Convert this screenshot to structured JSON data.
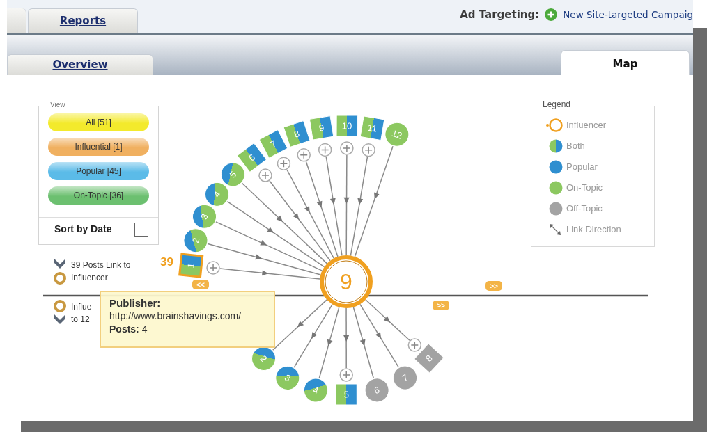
{
  "top_tabs": [
    {
      "label": "Reports",
      "selected": false
    }
  ],
  "ad_targeting": {
    "label": "Ad Targeting:",
    "link": "New Site-targeted Campaig"
  },
  "sub_tabs": [
    {
      "label": "Overview",
      "selected": false
    },
    {
      "label": "Map",
      "selected": true
    }
  ],
  "view_panel": {
    "title": "View",
    "filters": [
      {
        "label": "All [51]",
        "color": "#f3ea2c"
      },
      {
        "label": "Influential [1]",
        "color": "#f0b060"
      },
      {
        "label": "Popular [45]",
        "color": "#5bbbe8"
      },
      {
        "label": "On-Topic [36]",
        "color": "#6cc070"
      }
    ],
    "sort": {
      "label": "Sort by Date",
      "checked": false
    }
  },
  "legend": {
    "title": "Legend",
    "items": [
      {
        "kind": "influencer",
        "label": "Influencer"
      },
      {
        "kind": "both",
        "label": "Both"
      },
      {
        "kind": "popular",
        "label": "Popular"
      },
      {
        "kind": "on_topic",
        "label": "On-Topic"
      },
      {
        "kind": "off_topic",
        "label": "Off-Topic"
      },
      {
        "kind": "link_direction",
        "label": "Link Direction"
      }
    ]
  },
  "inbound": {
    "label": "39 Posts Link to Influencer",
    "count": "39"
  },
  "outbound": {
    "lines": [
      "Influe",
      "to 12"
    ]
  },
  "influencer": {
    "label": "9"
  },
  "inbound_nodes": [
    {
      "label": "1",
      "kind": "both",
      "expandable": true,
      "selected": true
    },
    {
      "label": "2",
      "kind": "both",
      "expandable": false,
      "selected": false
    },
    {
      "label": "3",
      "kind": "both",
      "expandable": false,
      "selected": false
    },
    {
      "label": "4",
      "kind": "both",
      "expandable": false,
      "selected": false
    },
    {
      "label": "5",
      "kind": "both",
      "expandable": false,
      "selected": false
    },
    {
      "label": "6",
      "kind": "both",
      "expandable": true,
      "selected": false
    },
    {
      "label": "7",
      "kind": "both",
      "expandable": true,
      "selected": false
    },
    {
      "label": "8",
      "kind": "both",
      "expandable": true,
      "selected": false
    },
    {
      "label": "9",
      "kind": "both",
      "expandable": true,
      "selected": false
    },
    {
      "label": "10",
      "kind": "both",
      "expandable": true,
      "selected": false
    },
    {
      "label": "11",
      "kind": "both",
      "expandable": true,
      "selected": false
    },
    {
      "label": "12",
      "kind": "on_topic",
      "expandable": false,
      "selected": false
    }
  ],
  "outbound_nodes": [
    {
      "label": "2",
      "kind": "both",
      "expandable": false,
      "selected": false
    },
    {
      "label": "3",
      "kind": "both",
      "expandable": false,
      "selected": false
    },
    {
      "label": "4",
      "kind": "both",
      "expandable": false,
      "selected": false
    },
    {
      "label": "5",
      "kind": "both",
      "expandable": true,
      "selected": false
    },
    {
      "label": "6",
      "kind": "off_topic",
      "expandable": false,
      "selected": false
    },
    {
      "label": "7",
      "kind": "off_topic",
      "expandable": false,
      "selected": false
    },
    {
      "label": "8",
      "kind": "off_topic",
      "expandable": true,
      "selected": false
    }
  ],
  "pagers": [
    {
      "label": "<<"
    },
    {
      "label": ">>"
    },
    {
      "label": ">>"
    }
  ],
  "tooltip": {
    "title": "Publisher:",
    "url": "http://www.brainshavings.com/",
    "posts": "**Posts:** 4"
  }
}
